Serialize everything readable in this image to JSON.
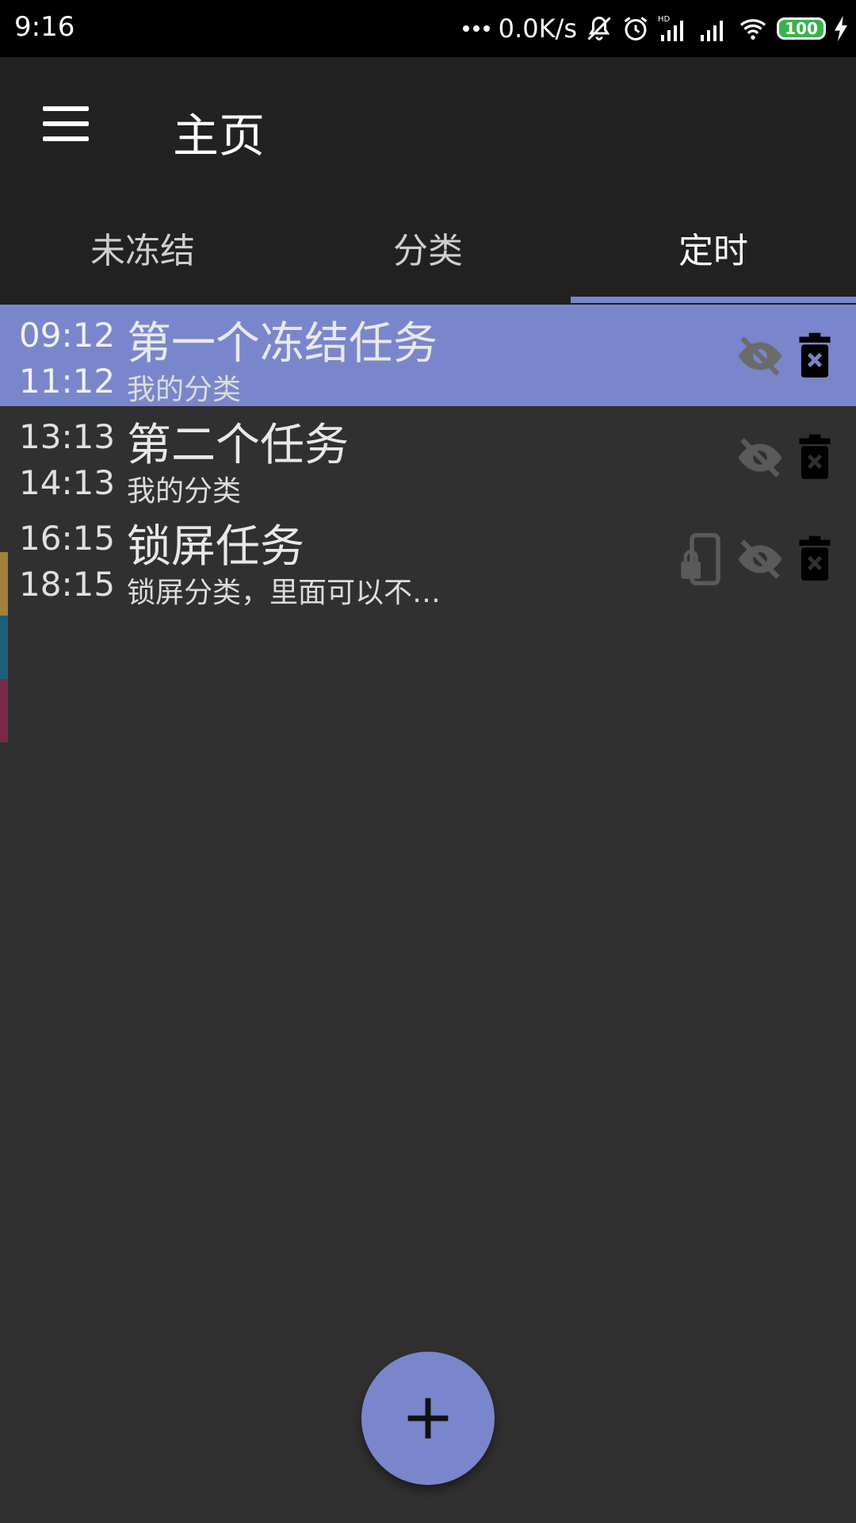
{
  "status_bar": {
    "time": "9:16",
    "network_speed": "0.0K/s",
    "battery": "100",
    "icons": [
      "dots-icon",
      "mute-icon",
      "alarm-icon",
      "hd-signal-icon",
      "signal-icon",
      "wifi-icon",
      "battery-icon",
      "charging-icon"
    ]
  },
  "app_bar": {
    "title": "主页",
    "menu_icon": "menu-icon"
  },
  "tabs": [
    {
      "label": "未冻结",
      "active": false
    },
    {
      "label": "分类",
      "active": false
    },
    {
      "label": "定时",
      "active": true
    }
  ],
  "tasks": [
    {
      "start": "09:12",
      "end": "11:12",
      "title": "第一个冻结任务",
      "category": "我的分类",
      "selected": true,
      "icons": [
        "hidden-eye-icon",
        "delete-icon"
      ]
    },
    {
      "start": "13:13",
      "end": "14:13",
      "title": "第二个任务",
      "category": "我的分类",
      "selected": false,
      "icons": [
        "hidden-eye-icon",
        "delete-icon"
      ]
    },
    {
      "start": "16:15",
      "end": "18:15",
      "title": "锁屏任务",
      "category": "锁屏分类，里面可以不…",
      "selected": false,
      "icons": [
        "lock-screen-icon",
        "hidden-eye-icon",
        "delete-icon"
      ]
    }
  ],
  "category_colors": [
    "#a0823a",
    "#1e5f7a",
    "#7a2848"
  ],
  "accent_color": "#7986cb",
  "fab": {
    "icon": "plus-icon"
  }
}
